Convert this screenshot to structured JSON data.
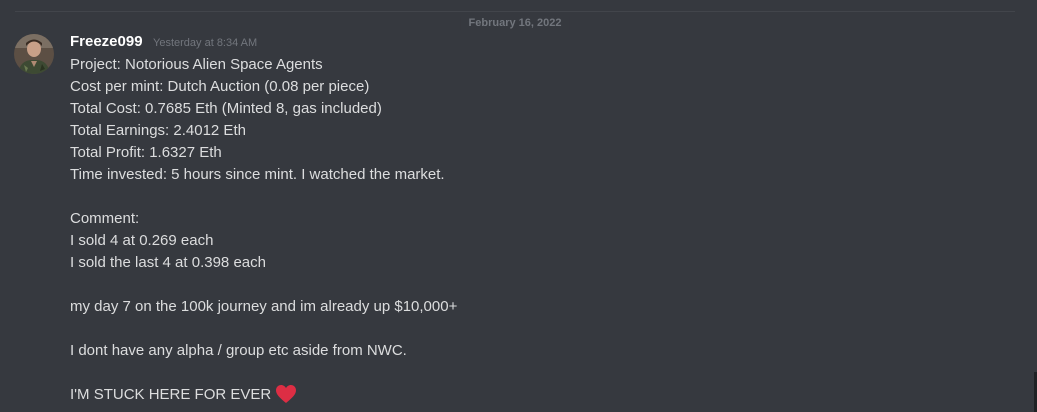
{
  "divider": {
    "date": "February 16, 2022"
  },
  "message": {
    "username": "Freeze099",
    "timestamp": "Yesterday at 8:34 AM",
    "lines": [
      "Project: Notorious Alien Space Agents",
      "Cost per mint: Dutch Auction (0.08 per piece)",
      "Total Cost: 0.7685 Eth (Minted 8, gas included)",
      "Total Earnings: 2.4012 Eth",
      "Total Profit: 1.6327 Eth",
      "Time invested: 5 hours since mint. I watched the market.",
      "",
      "Comment:",
      "I sold 4 at 0.269 each",
      "I sold the last 4 at 0.398 each",
      "",
      "my day 7 on the 100k journey and im already up $10,000+",
      "",
      "I dont have any alpha / group etc aside from NWC.",
      "",
      "I'M STUCK HERE FOR EVER"
    ],
    "emoji": "heart-icon"
  },
  "colors": {
    "background": "#36393f",
    "username": "#ffffff",
    "text": "#dcddde",
    "muted": "#72767d",
    "heart": "#dd2e44"
  }
}
